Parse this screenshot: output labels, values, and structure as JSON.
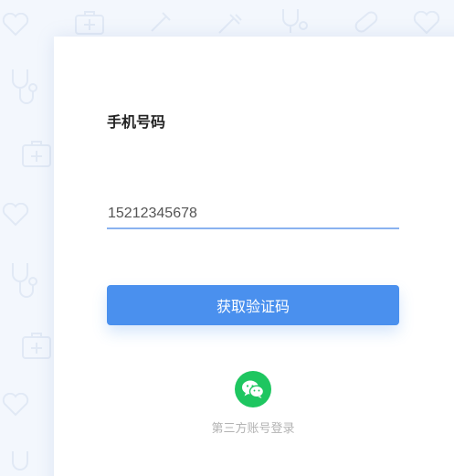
{
  "form": {
    "phone_label": "手机号码",
    "phone_value": "15212345678",
    "get_code_button": "获取验证码"
  },
  "third_party": {
    "icon": "wechat-icon",
    "label": "第三方账号登录"
  },
  "colors": {
    "accent": "#4a90ee",
    "input_underline": "#8ab2f0",
    "wechat": "#1ec660",
    "background": "#f3f7fd"
  }
}
